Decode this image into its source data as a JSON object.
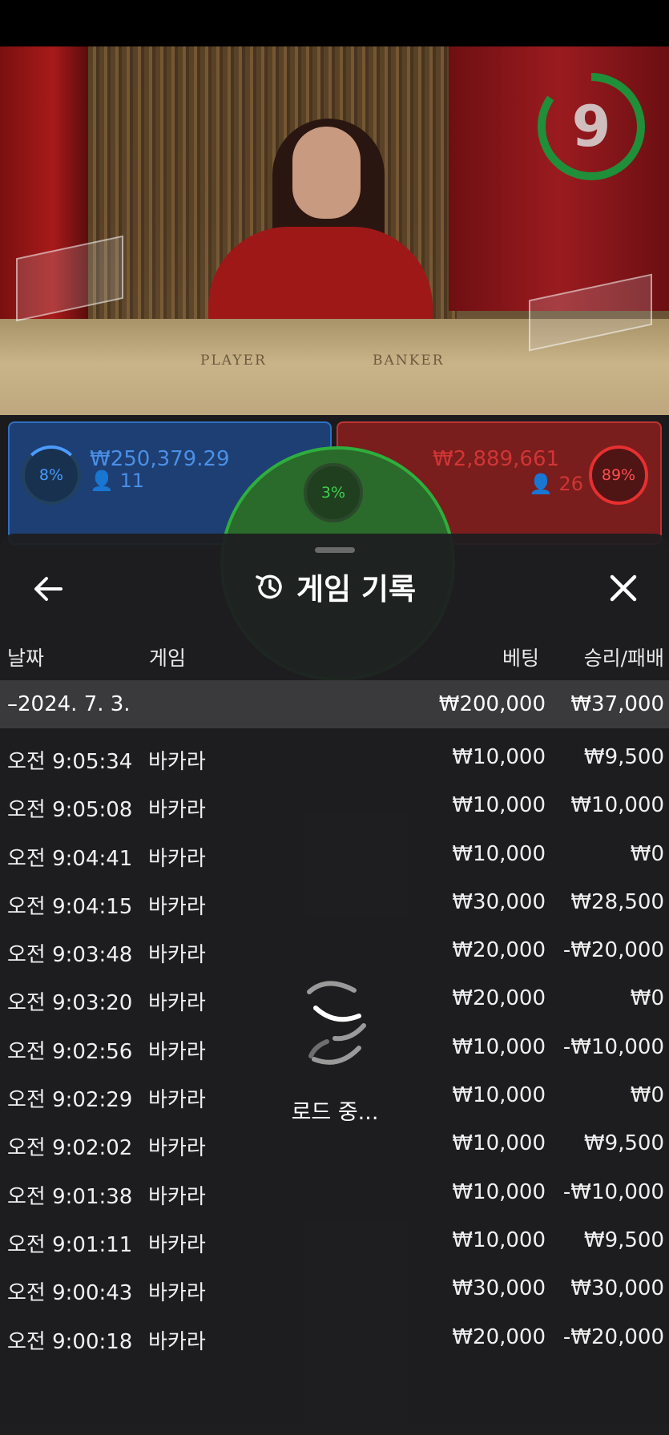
{
  "video": {
    "timer_value": "9",
    "table_labels": {
      "player": "PLAYER",
      "banker": "BANKER"
    }
  },
  "bet_panels": {
    "player": {
      "percent": "8%",
      "amount": "₩250,379.29",
      "players": "11"
    },
    "tie": {
      "percent": "3%"
    },
    "banker": {
      "percent": "89%",
      "amount": "₩2,889,661",
      "players": "26"
    }
  },
  "sheet": {
    "title": "게임 기록",
    "back_icon": "arrow-left-icon",
    "history_icon": "history-icon",
    "close_icon": "close-icon",
    "columns": {
      "date": "날짜",
      "game": "게임",
      "bet": "베팅",
      "win_loss": "승리/패배"
    },
    "date_group": {
      "label": "–2024. 7. 3.",
      "bet": "₩200,000",
      "win_loss": "₩37,000"
    },
    "rows": [
      {
        "time": "오전 9:05:34",
        "game": "바카라",
        "bet": "₩10,000",
        "win_loss": "₩9,500"
      },
      {
        "time": "오전 9:05:08",
        "game": "바카라",
        "bet": "₩10,000",
        "win_loss": "₩10,000"
      },
      {
        "time": "오전 9:04:41",
        "game": "바카라",
        "bet": "₩10,000",
        "win_loss": "₩0"
      },
      {
        "time": "오전 9:04:15",
        "game": "바카라",
        "bet": "₩30,000",
        "win_loss": "₩28,500"
      },
      {
        "time": "오전 9:03:48",
        "game": "바카라",
        "bet": "₩20,000",
        "win_loss": "-₩20,000"
      },
      {
        "time": "오전 9:03:20",
        "game": "바카라",
        "bet": "₩20,000",
        "win_loss": "₩0"
      },
      {
        "time": "오전 9:02:56",
        "game": "바카라",
        "bet": "₩10,000",
        "win_loss": "-₩10,000"
      },
      {
        "time": "오전 9:02:29",
        "game": "바카라",
        "bet": "₩10,000",
        "win_loss": "₩0"
      },
      {
        "time": "오전 9:02:02",
        "game": "바카라",
        "bet": "₩10,000",
        "win_loss": "₩9,500"
      },
      {
        "time": "오전 9:01:38",
        "game": "바카라",
        "bet": "₩10,000",
        "win_loss": "-₩10,000"
      },
      {
        "time": "오전 9:01:11",
        "game": "바카라",
        "bet": "₩10,000",
        "win_loss": "₩9,500"
      },
      {
        "time": "오전 9:00:43",
        "game": "바카라",
        "bet": "₩30,000",
        "win_loss": "₩30,000"
      },
      {
        "time": "오전 9:00:18",
        "game": "바카라",
        "bet": "₩20,000",
        "win_loss": "-₩20,000"
      }
    ],
    "loading_text": "로드 중...",
    "loading_icon": "spinner-icon"
  },
  "colors": {
    "player_blue": "#2f6fc4",
    "banker_red": "#c03333",
    "tie_green": "#2fae3d",
    "sheet_bg": "#1e1e20"
  }
}
